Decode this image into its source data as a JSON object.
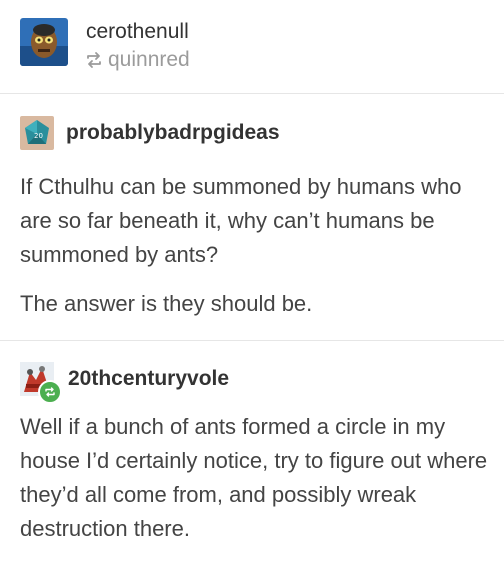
{
  "header": {
    "username": "cerothenull",
    "reblogged_from": "quinnred"
  },
  "posts": [
    {
      "username": "probablybadrpgideas",
      "paragraphs": [
        "If Cthulhu can be summoned by humans who are so far beneath it, why can’t humans be summoned by ants?",
        "The answer is they should be."
      ]
    },
    {
      "username": "20thcenturyvole",
      "paragraphs": [
        "Well if a bunch of ants formed a circle in my house I’d certainly notice, try to figure out where they’d all come from, and possibly wreak destruction there."
      ]
    }
  ],
  "colors": {
    "reblog_badge": "#4caf50",
    "text": "#444444",
    "muted": "#9b9b9b",
    "divider": "#e6e6e6"
  }
}
